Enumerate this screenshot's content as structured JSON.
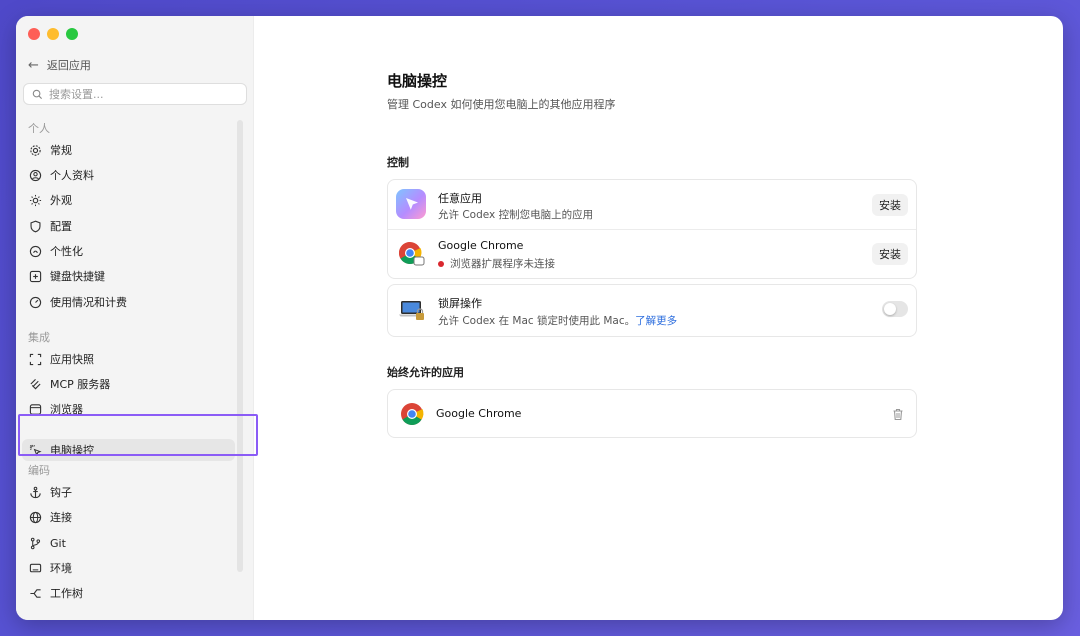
{
  "sidebar": {
    "back_label": "返回应用",
    "search_placeholder": "搜索设置...",
    "sections": {
      "personal": "个人",
      "integrations": "集成",
      "coding": "编码"
    },
    "personal_items": [
      "常规",
      "个人资料",
      "外观",
      "配置",
      "个性化",
      "键盘快捷键",
      "使用情况和计费"
    ],
    "integration_items": [
      "应用快照",
      "MCP 服务器",
      "浏览器",
      "电脑操控"
    ],
    "coding_items": [
      "钩子",
      "连接",
      "Git",
      "环境",
      "工作树"
    ],
    "active_item": "电脑操控"
  },
  "main": {
    "title": "电脑操控",
    "subtitle": "管理 Codex 如何使用您电脑上的其他应用程序",
    "control_section": "控制",
    "any_app": {
      "title": "任意应用",
      "description": "允许 Codex 控制您电脑上的应用",
      "button": "安装"
    },
    "chrome": {
      "title": "Google Chrome",
      "status": "浏览器扩展程序未连接",
      "button": "安装",
      "status_color": "#d9272e"
    },
    "lock_screen": {
      "title": "锁屏操作",
      "description": "允许 Codex 在 Mac 锁定时使用此 Mac。",
      "link": "了解更多",
      "enabled": false
    },
    "always_allowed_section": "始终允许的应用",
    "always_allowed": [
      {
        "name": "Google Chrome"
      }
    ]
  },
  "colors": {
    "accent_highlight": "#8b5cf6",
    "link": "#2f6fde",
    "background": "#5a55d6"
  }
}
